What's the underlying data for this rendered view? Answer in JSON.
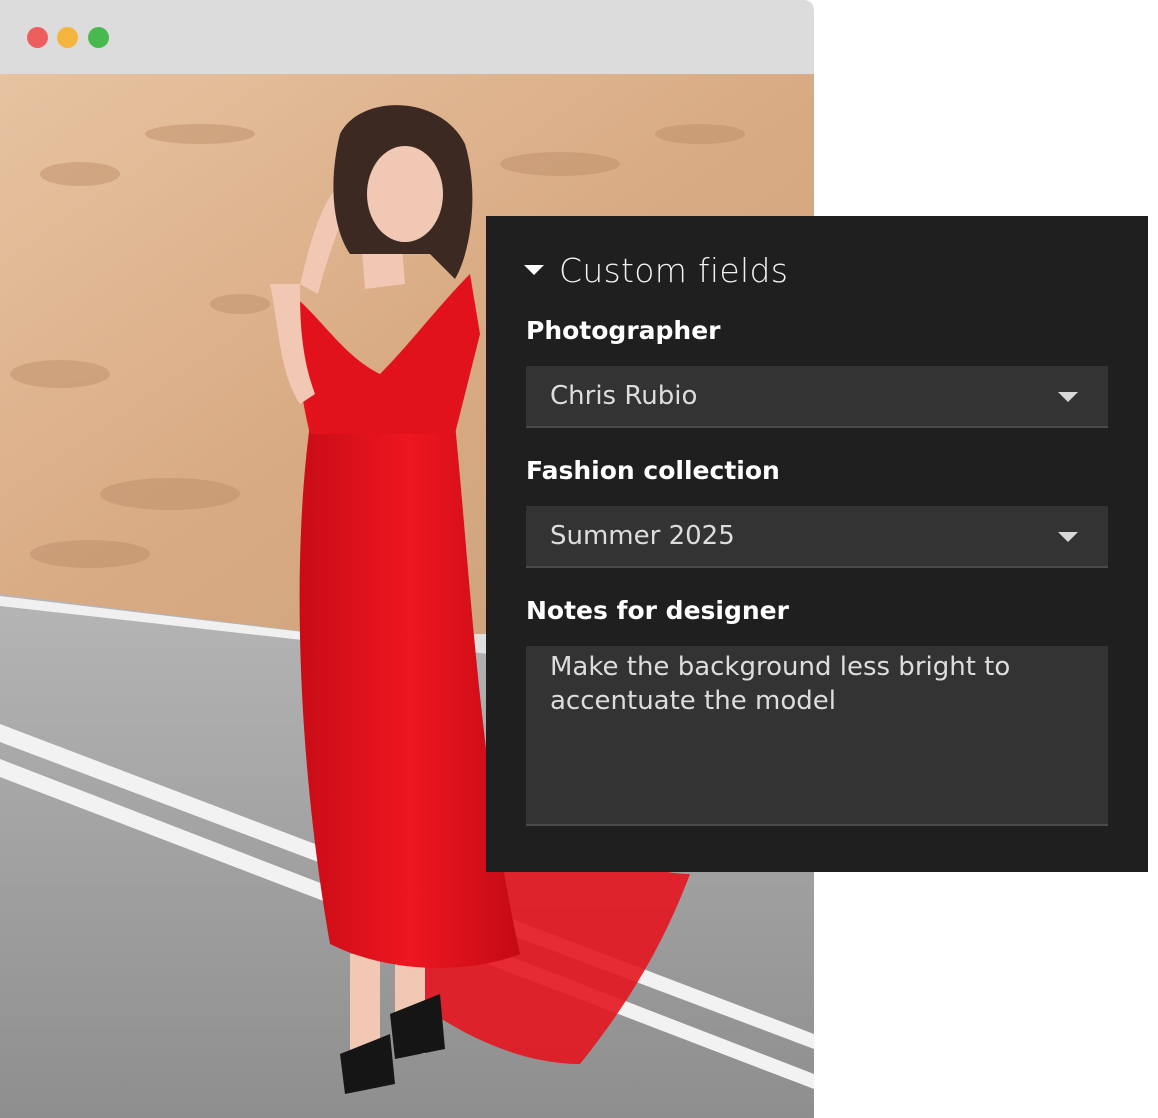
{
  "window": {
    "controls": [
      {
        "name": "close",
        "color": "#ed5f5f"
      },
      {
        "name": "minimize",
        "color": "#f4b53e"
      },
      {
        "name": "maximize",
        "color": "#48b94f"
      }
    ]
  },
  "photo": {
    "colors": {
      "rock": "#dcb18c",
      "road": "#9b9b9b",
      "dress": "#e8121c",
      "hair": "#3c2a22",
      "skin": "#f1c8b4"
    }
  },
  "panel": {
    "title": "Custom fields",
    "fields": [
      {
        "label": "Photographer",
        "value": "Chris Rubio"
      },
      {
        "label": "Fashion collection",
        "value": "Summer 2025"
      }
    ],
    "notes": {
      "label": "Notes for designer",
      "value": "Make the background less bright to accentuate the model"
    }
  }
}
